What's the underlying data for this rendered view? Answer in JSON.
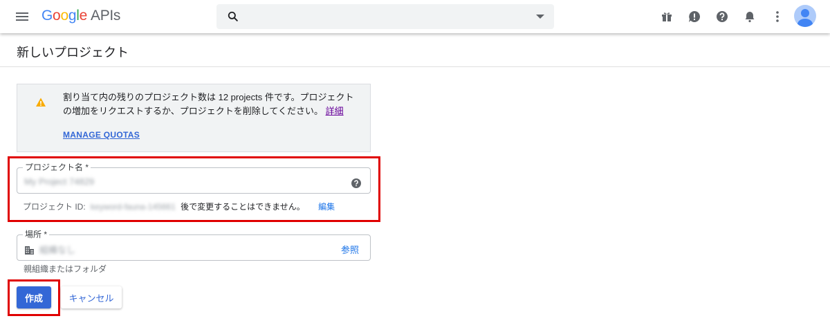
{
  "header": {
    "logo_google": [
      "G",
      "o",
      "o",
      "g",
      "l",
      "e"
    ],
    "logo_suffix": "APIs",
    "search": {
      "value": "",
      "placeholder": ""
    },
    "icons": [
      "gift-icon",
      "feedback-icon",
      "help-icon",
      "notifications-icon",
      "more-vert-icon"
    ]
  },
  "page": {
    "title": "新しいプロジェクト"
  },
  "notice": {
    "text": "割り当て内の残りのプロジェクト数は 12 projects 件です。プロジェクトの増加をリクエストするか、プロジェクトを削除してください。",
    "details_link": "詳細",
    "manage_quotas": "MANAGE QUOTAS"
  },
  "form": {
    "project_name": {
      "label": "プロジェクト名 *",
      "value": "My Project 74829"
    },
    "project_id": {
      "label": "プロジェクト ID:",
      "value": "keyword-fauna-145661",
      "note": "後で変更することはできません。",
      "edit": "編集"
    },
    "location": {
      "label": "場所 *",
      "value": "組織なし",
      "browse": "参照",
      "helper": "親組織またはフォルダ"
    }
  },
  "actions": {
    "create": "作成",
    "cancel": "キャンセル"
  },
  "colors": {
    "primary": "#3367d6",
    "highlight": "#e00000",
    "warning": "#f9ab00"
  }
}
